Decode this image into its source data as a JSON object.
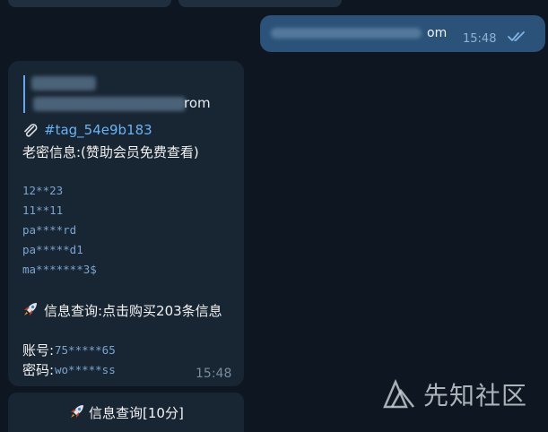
{
  "outgoing": {
    "text_tail": "om",
    "time": "15:48",
    "status_icon": "double-check-icon"
  },
  "incoming": {
    "quote_suffix": "rom",
    "hashtag": "#tag_54e9b183",
    "header": "老密信息:(赞助会员免费查看)",
    "password_hints": [
      "12**23",
      "11**11",
      "pa****rd",
      "pa*****d1",
      "ma*******3$"
    ],
    "query_label": "信息查询:点击购买203条信息",
    "account_label": "账号:",
    "account_value": "75*****65",
    "password_label": "密码:",
    "password_value": "wo*****ss",
    "time": "15:48"
  },
  "next_message": {
    "text": "信息查询[10分]"
  },
  "watermark": {
    "text": "先知社区",
    "icon": "xianzhi-logo"
  },
  "colors": {
    "background": "#0e1621",
    "outgoing_bubble": "#2b5278",
    "incoming_bubble": "#182533",
    "link": "#6ab3f3",
    "mono_text": "#7aa5cf"
  }
}
